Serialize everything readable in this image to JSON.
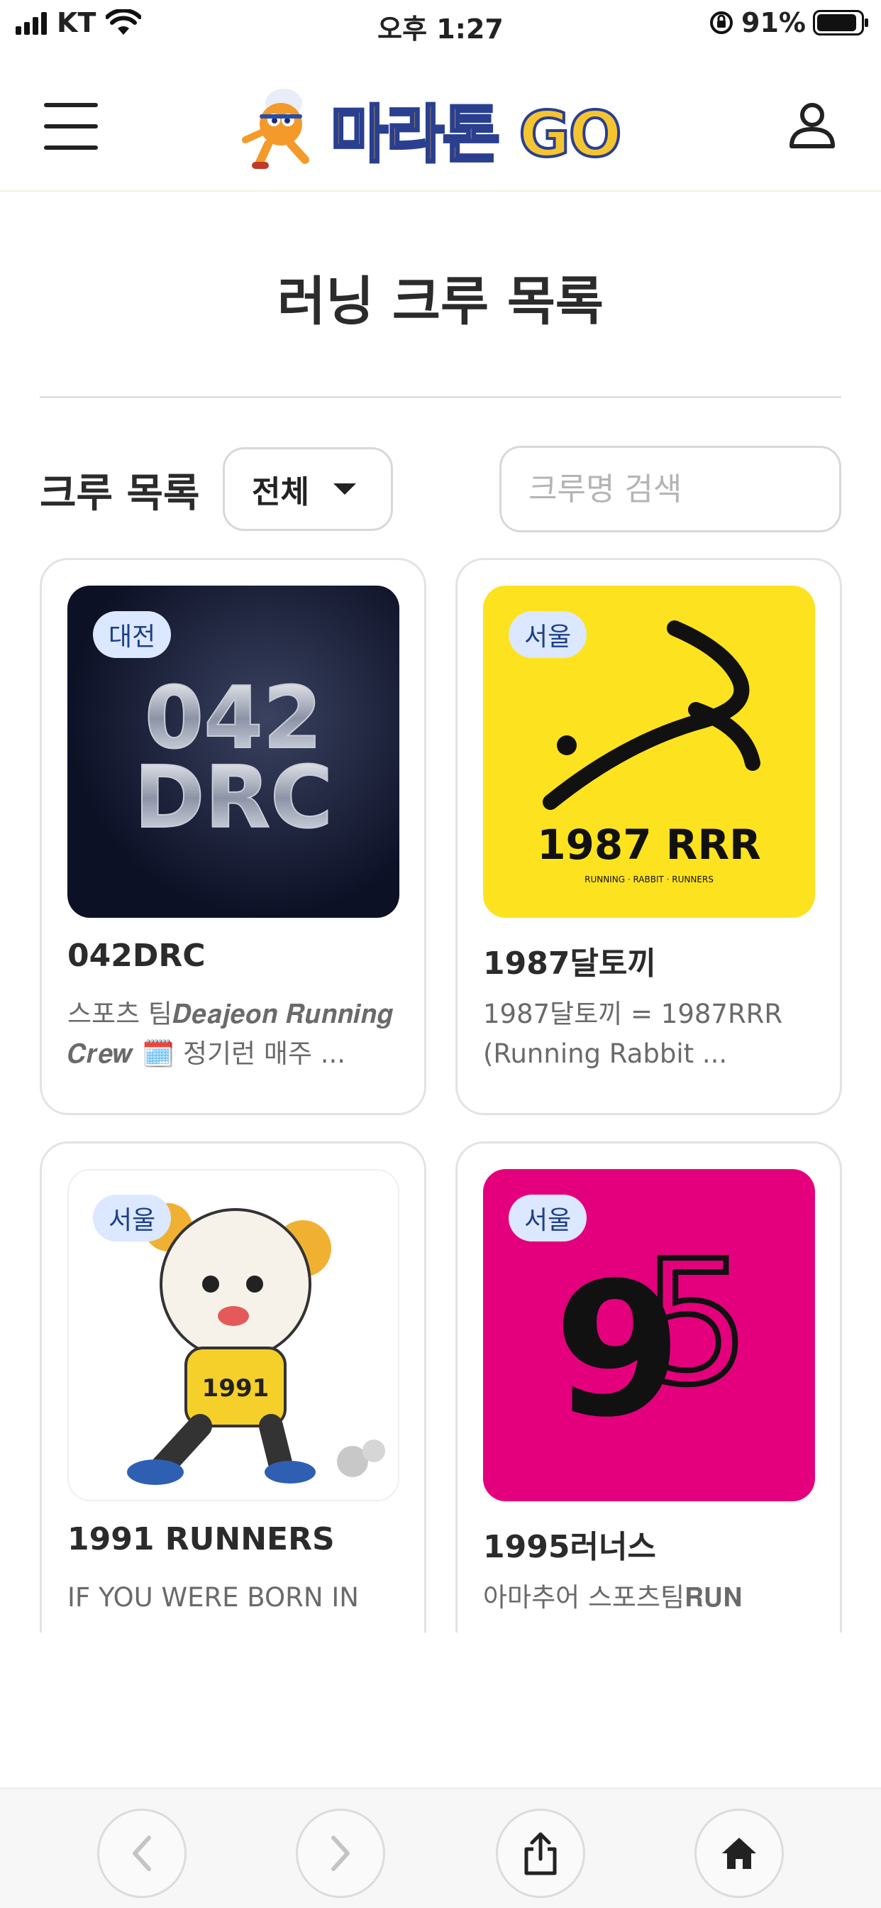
{
  "status_bar": {
    "carrier": "KT",
    "time": "오후 1:27",
    "battery": "91%",
    "battery_level": 0.91
  },
  "header": {
    "logo_text": "마라톤 GO",
    "logo_text_color": "#f5c531",
    "logo_outline_color": "#2a3f8f",
    "menu_icon": "hamburger-menu-icon",
    "user_icon": "user-profile-icon"
  },
  "page": {
    "title": "러닝 크루 목록"
  },
  "toolbar": {
    "list_label": "크루 목록",
    "region_select_value": "전체",
    "search_placeholder": "크루명 검색"
  },
  "crews": [
    {
      "region": "대전",
      "name": "042DRC",
      "description": "스포츠 팀𝑫𝒆𝒂𝒋𝒆𝒐𝒏 𝑹𝒖𝒏𝒏𝒊𝒏𝒈 𝑪𝒓𝒆𝒘 🗓️ 정기런 매주 ...",
      "logo_lines": [
        "042",
        "DRC"
      ]
    },
    {
      "region": "서울",
      "name": "1987달토끼",
      "description": "1987달토끼 = 1987RRR (Running Rabbit ...",
      "logo_lines": [
        "1987 RRR",
        "RUNNING · RABBIT · RUNNERS"
      ]
    },
    {
      "region": "서울",
      "name": "1991 RUNNERS",
      "description": "IF YOU WERE BORN IN",
      "logo_lines": [
        "1991"
      ]
    },
    {
      "region": "서울",
      "name": "1995러너스",
      "description": "아마추어 스포츠팀𝐑𝐔𝐍",
      "logo_lines": [
        "9",
        "5"
      ]
    }
  ],
  "bottom_bar": {
    "back_icon": "chevron-left-icon",
    "forward_icon": "chevron-right-icon",
    "share_icon": "share-icon",
    "home_icon": "home-icon"
  }
}
